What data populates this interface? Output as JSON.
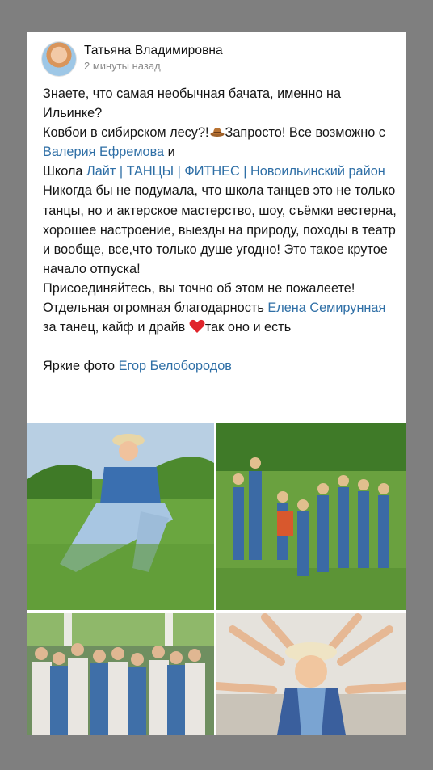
{
  "post": {
    "author": "Татьяна Владимировна",
    "time": "2 минуты назад",
    "line1": "Знаете, что самая необычная бачата, именно на Ильинке?",
    "line2_a": "Ковбои в сибирском лесу?!",
    "line2_b": "Запросто! Все возможно с ",
    "link_valeria": "Валерия Ефремова",
    "line2_c": " и",
    "line3_a": "Школа ",
    "link_school": "Лайт | ТАНЦЫ | ФИТНЕС | Новоильинский район",
    "line4": "Никогда бы не подумала, что школа танцев это не только танцы, но и актерское мастерство, шоу, съёмки вестерна, хорошее настроение, выезды на природу, походы в театр и вообще, все,что только душе угодно! Это такое крутое начало отпуска!",
    "line5": "Присоединяйтесь, вы точно об этом не пожалеете!",
    "line6_a": "Отдельная огромная благодарность ",
    "link_elena": "Елена Семирунная",
    "line6_b": " за танец, кайф и драйв ",
    "line6_c": "так оно и есть",
    "credit_a": "Яркие фото ",
    "link_egor": "Егор Белобородов"
  },
  "icons": {
    "cowboy": "cowboy-emoji-icon",
    "heart": "red-heart-emoji-icon"
  },
  "colors": {
    "link": "#2f6fa6",
    "background": "#7f7f7f",
    "card": "#ffffff"
  }
}
